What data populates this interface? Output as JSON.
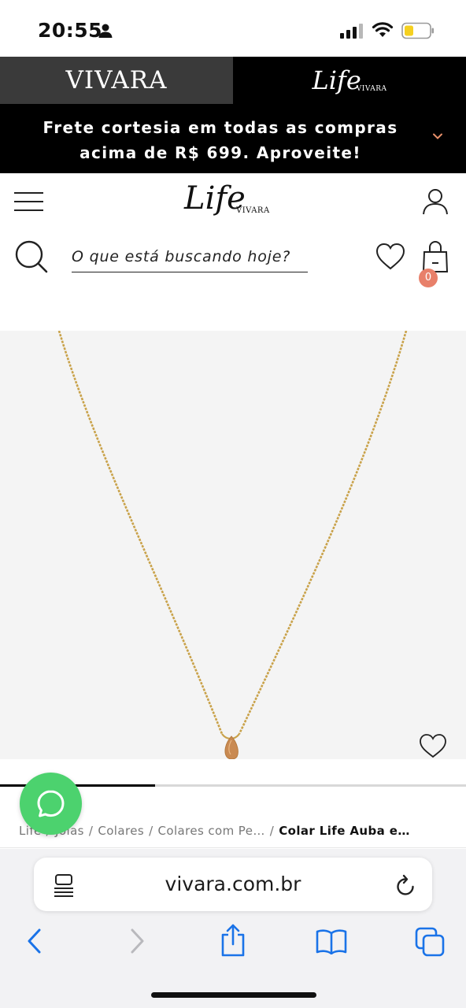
{
  "status_bar": {
    "time": "20:55",
    "icons": [
      "person-icon",
      "signal-icon",
      "wifi-icon",
      "battery-icon"
    ],
    "battery_color": "#f5d020"
  },
  "brand_header": {
    "vivara_label": "VIVARA",
    "life_label": "Life",
    "life_sub_label": "VIVARA"
  },
  "promo": {
    "line1": "Frete cortesia em todas as compras",
    "line2": "acima de R$ 699. Aproveite!",
    "chevron_icon": "chevron-down-icon",
    "chevron_color": "#e8906a"
  },
  "nav": {
    "menu_icon": "hamburger-menu-icon",
    "logo_script": "Life",
    "logo_sub": "VIVARA",
    "user_icon": "user-icon"
  },
  "search": {
    "placeholder": "O que está buscando hoje?",
    "value": "",
    "search_icon": "search-icon",
    "wishlist_icon": "heart-icon",
    "bag_icon": "shopping-bag-icon",
    "bag_count": "0",
    "badge_color": "#e8806a"
  },
  "product": {
    "image_icon": "necklace-image",
    "favorite_icon": "heart-icon",
    "carousel_progress": 0.333
  },
  "breadcrumb": {
    "items": [
      "Life",
      "Joias",
      "Colares",
      "Colares com Pe…"
    ],
    "current": "Colar Life Auba e…"
  },
  "whatsapp": {
    "icon": "whatsapp-icon",
    "color": "#4cd26e"
  },
  "browser": {
    "url": "vivara.com.br",
    "page_menu_icon": "page-menu-icon",
    "reload_icon": "reload-icon",
    "toolbar": [
      "back-icon",
      "forward-icon",
      "share-icon",
      "bookmarks-icon",
      "tabs-icon"
    ],
    "accent_color": "#1a73e8"
  }
}
